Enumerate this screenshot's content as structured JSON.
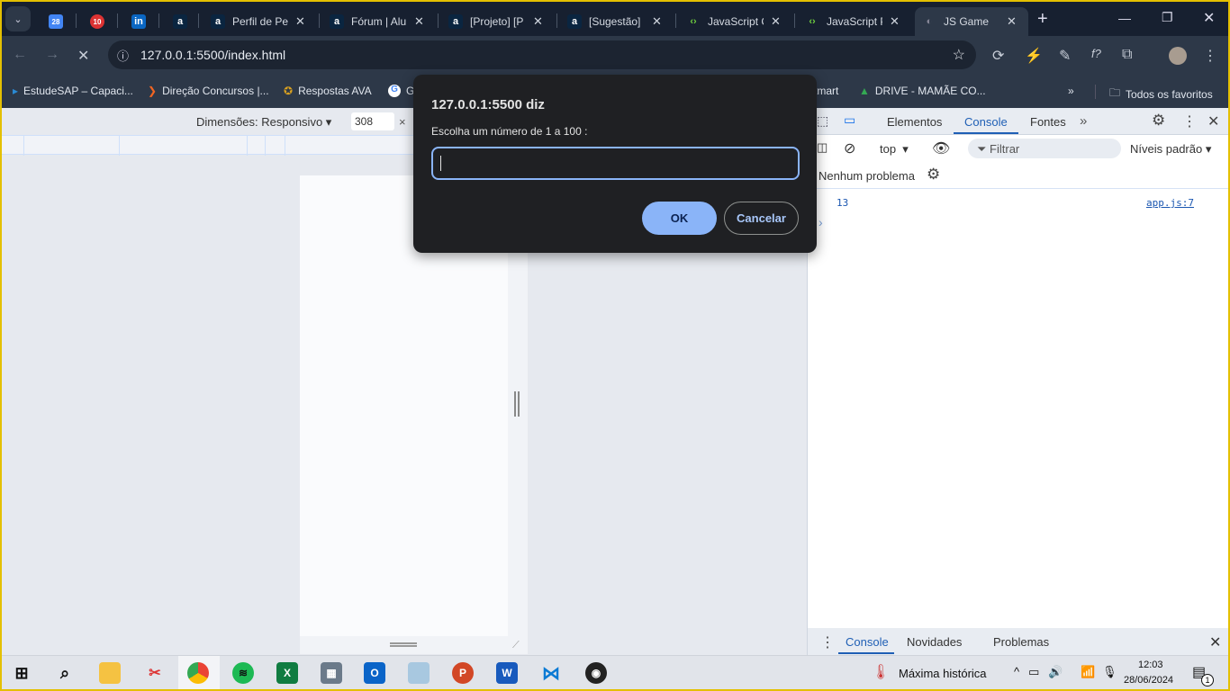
{
  "browser": {
    "tabs": [
      {
        "title": "",
        "icon": "calendar-icon"
      },
      {
        "title": "",
        "icon": "notification-10-icon"
      },
      {
        "title": "",
        "icon": "linkedin-icon"
      },
      {
        "title": "",
        "icon": "alura-icon"
      },
      {
        "title": "Perfil de Pe",
        "icon": "alura-icon"
      },
      {
        "title": "Fórum | Alu",
        "icon": "alura-icon"
      },
      {
        "title": "[Projeto] [P",
        "icon": "alura-icon"
      },
      {
        "title": "[Sugestão]",
        "icon": "alura-icon"
      },
      {
        "title": "JavaScript C",
        "icon": "code-icon"
      },
      {
        "title": "JavaScript P",
        "icon": "code-icon"
      },
      {
        "title": "JS Game",
        "icon": "loading-globe-icon",
        "active": true
      }
    ],
    "url": "127.0.0.1:5500/index.html",
    "bookmarks": [
      "EstudeSAP – Capaci...",
      "Direção Concursos |...",
      "Respostas AVA",
      "G",
      "tmart",
      "DRIVE - MAMÃE CO..."
    ],
    "all_bookmarks": "Todos os favoritos"
  },
  "device_toolbar": {
    "dimensions_label": "Dimensões: Responsivo",
    "width_value": "308",
    "times": "×"
  },
  "dialog": {
    "title": "127.0.0.1:5500 diz",
    "message": "Escolha um número de 1 a 100 :",
    "input_value": "",
    "ok_label": "OK",
    "cancel_label": "Cancelar"
  },
  "devtools": {
    "tabs": [
      "Elementos",
      "Console",
      "Fontes"
    ],
    "active_tab": "Console",
    "context": "top",
    "filter_placeholder": "Filtrar",
    "levels": "Níveis padrão",
    "issues": "Nenhum problema",
    "logs": [
      {
        "value": "13",
        "source": "app.js:7"
      }
    ],
    "prompt": "›",
    "drawer_tabs": [
      "Console",
      "Novidades",
      "Problemas"
    ]
  },
  "taskbar": {
    "weather": "Máxima histórica",
    "time": "12:03",
    "date": "28/06/2024",
    "notifications": "1"
  },
  "colors": {
    "accent": "#8ab4f8",
    "console_blue": "#1a56b0",
    "devtools_active": "#1f5fb5"
  }
}
